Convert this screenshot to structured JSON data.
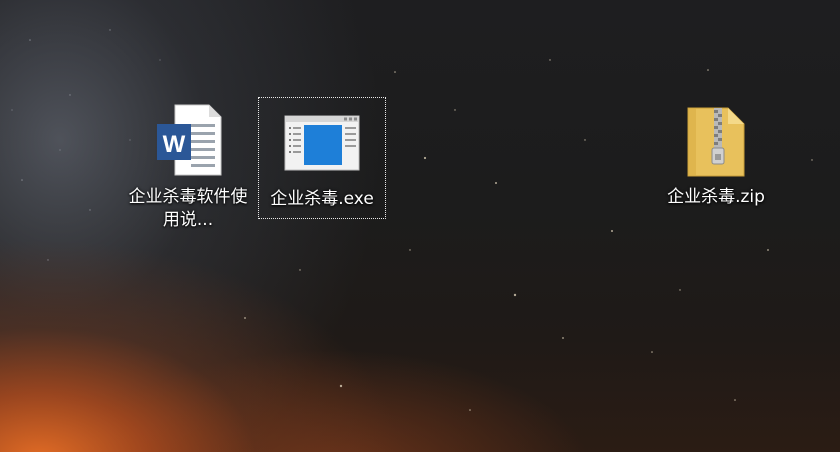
{
  "desktop": {
    "icons": [
      {
        "label": "企业杀毒软件使用说...",
        "type": "word-document-icon"
      },
      {
        "label": "企业杀毒.exe",
        "type": "application-exe-icon",
        "selected": true
      },
      {
        "label": "企业杀毒.zip",
        "type": "zip-folder-icon"
      }
    ]
  },
  "colors": {
    "word_blue": "#2b5797",
    "exe_blue": "#1e7fd8",
    "zip_yellow": "#e8c15c"
  }
}
